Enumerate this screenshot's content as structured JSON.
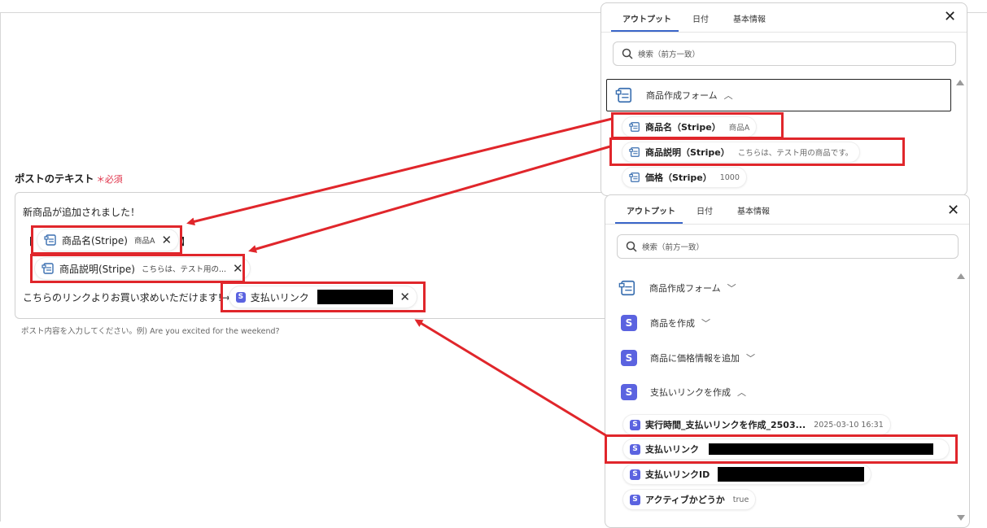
{
  "field": {
    "label": "ポストのテキスト",
    "required": "＊必須",
    "line1": "新商品が追加されました！",
    "bracket_open": "【",
    "bracket_close": "】",
    "line3": "こちらのリンクよりお買い求めいただけます!→",
    "hint": "ポスト内容を入力してください。例) Are you excited for the weekend?"
  },
  "tokens": {
    "name": {
      "label": "商品名(Stripe)",
      "value": "商品A"
    },
    "desc": {
      "label": "商品説明(Stripe)",
      "value": "こちらは、テスト用の..."
    },
    "link": {
      "label": "支払いリンク"
    }
  },
  "panel1": {
    "tabs": [
      "アウトプット",
      "日付",
      "基本情報"
    ],
    "search_placeholder": "検索（前方一致）",
    "group": "商品作成フォーム",
    "items": [
      {
        "label": "商品名（Stripe）",
        "value": "商品A"
      },
      {
        "label": "商品説明（Stripe）",
        "value": "こちらは、テスト用の商品です。"
      },
      {
        "label": "価格（Stripe）",
        "value": "1000"
      }
    ]
  },
  "panel2": {
    "tabs": [
      "アウトプット",
      "日付",
      "基本情報"
    ],
    "search_placeholder": "検索（前方一致）",
    "groups": [
      "商品作成フォーム",
      "商品を作成",
      "商品に価格情報を追加",
      "支払いリンクを作成"
    ],
    "items": [
      {
        "label": "実行時間_支払いリンクを作成_2503...",
        "value": "2025-03-10 16:31"
      },
      {
        "label": "支払いリンク",
        "value": ""
      },
      {
        "label": "支払いリンクID",
        "value": ""
      },
      {
        "label": "アクティブかどうか",
        "value": "true"
      }
    ]
  },
  "colors": {
    "accent_red": "#e0262b",
    "stripe_purple": "#5b63e0",
    "tab_blue": "#3a66c9"
  },
  "icons": {
    "form": "form-icon",
    "stripe": "stripe-icon",
    "search": "search-icon",
    "close": "close-icon"
  }
}
